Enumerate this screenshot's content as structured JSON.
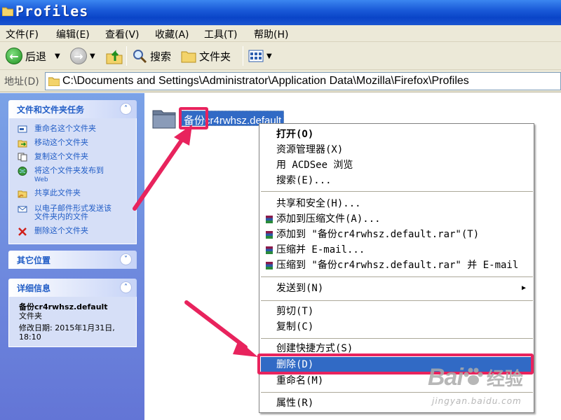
{
  "window": {
    "title": "Profiles"
  },
  "menubar": {
    "items": [
      "文件(F)",
      "编辑(E)",
      "查看(V)",
      "收藏(A)",
      "工具(T)",
      "帮助(H)"
    ]
  },
  "toolbar": {
    "back_label": "后退",
    "search_label": "搜索",
    "folders_label": "文件夹"
  },
  "address": {
    "label": "地址(D)",
    "path": "C:\\Documents and Settings\\Administrator\\Application Data\\Mozilla\\Firefox\\Profiles"
  },
  "taskpane": {
    "tasks": {
      "title": "文件和文件夹任务",
      "items": [
        {
          "label": "重命名这个文件夹",
          "icon": "rename-icon"
        },
        {
          "label": "移动这个文件夹",
          "icon": "move-icon"
        },
        {
          "label": "复制这个文件夹",
          "icon": "copy-icon"
        },
        {
          "label": "将这个文件夹发布到",
          "label2": "Web",
          "icon": "publish-web-icon"
        },
        {
          "label": "共享此文件夹",
          "icon": "share-icon"
        },
        {
          "label": "以电子邮件形式发送该",
          "label2": "文件夹内的文件",
          "icon": "email-icon"
        },
        {
          "label": "删除这个文件夹",
          "icon": "delete-icon"
        }
      ]
    },
    "other_places": {
      "title": "其它位置"
    },
    "details": {
      "title": "详细信息",
      "name": "备份cr4rwhsz.default",
      "type": "文件夹",
      "modified_line1": "修改日期: 2015年1月31日,",
      "modified_line2": "18:10"
    }
  },
  "content": {
    "folder_name": "备份cr4rwhsz.default"
  },
  "context_menu": {
    "items": [
      {
        "label": "打开(O)",
        "bold": true
      },
      {
        "label": "资源管理器(X)"
      },
      {
        "label": "用 ACDSee 浏览"
      },
      {
        "label": "搜索(E)..."
      },
      {
        "label": "共享和安全(H)..."
      },
      {
        "label": "添加到压缩文件(A)...",
        "icon": "rar-icon"
      },
      {
        "label": "添加到 \"备份cr4rwhsz.default.rar\"(T)",
        "icon": "rar-icon"
      },
      {
        "label": "压缩并 E-mail...",
        "icon": "rar-icon"
      },
      {
        "label": "压缩到 \"备份cr4rwhsz.default.rar\" 并 E-mail",
        "icon": "rar-icon"
      },
      {
        "label": "发送到(N)",
        "submenu": true
      },
      {
        "label": "剪切(T)"
      },
      {
        "label": "复制(C)"
      },
      {
        "label": "创建快捷方式(S)"
      },
      {
        "label": "删除(D)",
        "highlighted": true
      },
      {
        "label": "重命名(M)"
      },
      {
        "label": "属性(R)"
      }
    ]
  },
  "watermark": {
    "brand": "Bai",
    "brand2": "经验",
    "url": "jingyan.baidu.com"
  },
  "colors": {
    "selection": "#316ac5",
    "annotation": "#e8235d",
    "taskpane_link": "#215dc6"
  }
}
